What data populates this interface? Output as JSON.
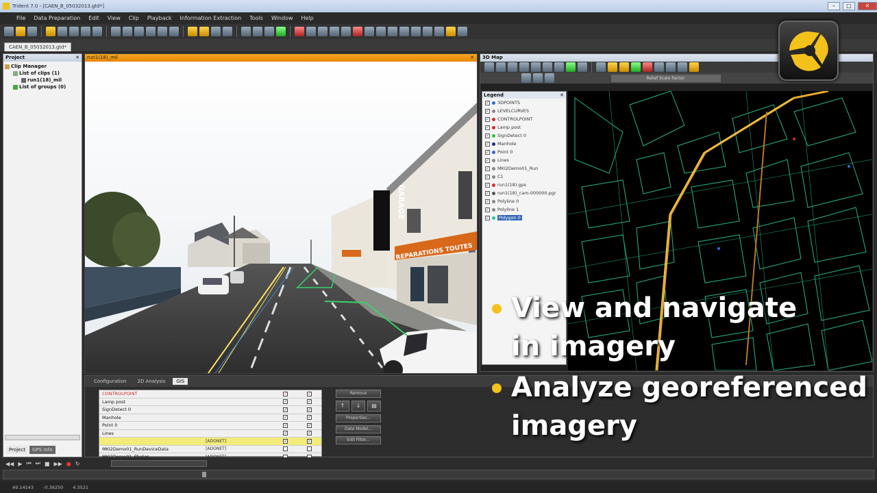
{
  "window": {
    "title": "Trident 7.0 - [CAEN_B_05032013.gtd*]"
  },
  "menu": [
    "File",
    "Data Preparation",
    "Edit",
    "View",
    "Clip",
    "Playback",
    "Information Extraction",
    "Tools",
    "Window",
    "Help"
  ],
  "document_tab": "CAEN_B_05032013.gtd*",
  "project_panel": {
    "title": "Project",
    "tree": [
      "Clip Manager",
      "List of clips (1)",
      "run1(18)_mil",
      "List of groups (0)"
    ],
    "tabs": [
      "Project",
      "GPS Info"
    ]
  },
  "viewport": {
    "title": "run1(18)_mil",
    "signs": {
      "garage": "GARAGE",
      "shop": "REPARATIONS TOUTES"
    }
  },
  "map3d": {
    "title": "3D Map",
    "relief_label": "Relief Scale Factor:",
    "legend_title": "Legend",
    "legend_items": [
      {
        "label": "3DPOINTS",
        "color": "#2a6bd8"
      },
      {
        "label": "LEVELCURVES",
        "color": "#888888"
      },
      {
        "label": "CONTROLPOINT",
        "color": "#d82a2a"
      },
      {
        "label": "Lamp post",
        "color": "#d82a2a"
      },
      {
        "label": "SignDetect 0",
        "color": "#2ac83a"
      },
      {
        "label": "Manhole",
        "color": "#1a2a8a"
      },
      {
        "label": "Point 0",
        "color": "#2a6bd8"
      },
      {
        "label": "Lines",
        "color": "#888888"
      },
      {
        "label": "MKI2Demo01_Run",
        "color": "#888888"
      },
      {
        "label": "C1",
        "color": "#888888"
      },
      {
        "label": "run1(18).gps",
        "color": "#d82a2a"
      },
      {
        "label": "run1(18)_cam-000000.pgr",
        "color": "#555555"
      },
      {
        "label": "Polyline 0",
        "color": "#888888"
      },
      {
        "label": "Polyline 1",
        "color": "#888888"
      },
      {
        "label": "Polygon 0",
        "color": "#2ac8a0"
      }
    ],
    "selected_index": 14
  },
  "bottom_panel": {
    "tabs": [
      "Configuration",
      "2D Analysis",
      "GIS"
    ],
    "active_tab": 2,
    "rows": [
      {
        "name": "CONTROLPOINT",
        "type": "",
        "c1": true,
        "c2": true
      },
      {
        "name": "Lamp post",
        "type": "",
        "c1": true,
        "c2": true
      },
      {
        "name": "SignDetect 0",
        "type": "",
        "c1": true,
        "c2": true
      },
      {
        "name": "Manhole",
        "type": "",
        "c1": true,
        "c2": true
      },
      {
        "name": "Point 0",
        "type": "",
        "c1": true,
        "c2": true
      },
      {
        "name": "Lines",
        "type": "",
        "c1": true,
        "c2": true
      },
      {
        "name": "",
        "type": "[ADONET]",
        "c1": true,
        "c2": true
      },
      {
        "name": "MKI2Demo01_RunDeviceData",
        "type": "[ADONET]",
        "c1": false,
        "c2": false
      },
      {
        "name": "MKI2Demo01_Photos",
        "type": "[ADONET]",
        "c1": false,
        "c2": false
      }
    ],
    "buttons": {
      "remove": "Remove",
      "properties": "Properties...",
      "data_model": "Data Model...",
      "edit_filter": "Edit Filter..."
    }
  },
  "overlay": {
    "bullet1": [
      "View and navigate",
      "in imagery"
    ],
    "bullet2": [
      "Analyze georeferenced",
      "imagery"
    ]
  },
  "status_bar": [
    "49.14143",
    "-0.36250",
    "4.3521"
  ],
  "colors": {
    "accent_orange": "#f5a623",
    "bullet_yellow": "#f3c21a",
    "logo_yellow": "#f3c21a"
  }
}
